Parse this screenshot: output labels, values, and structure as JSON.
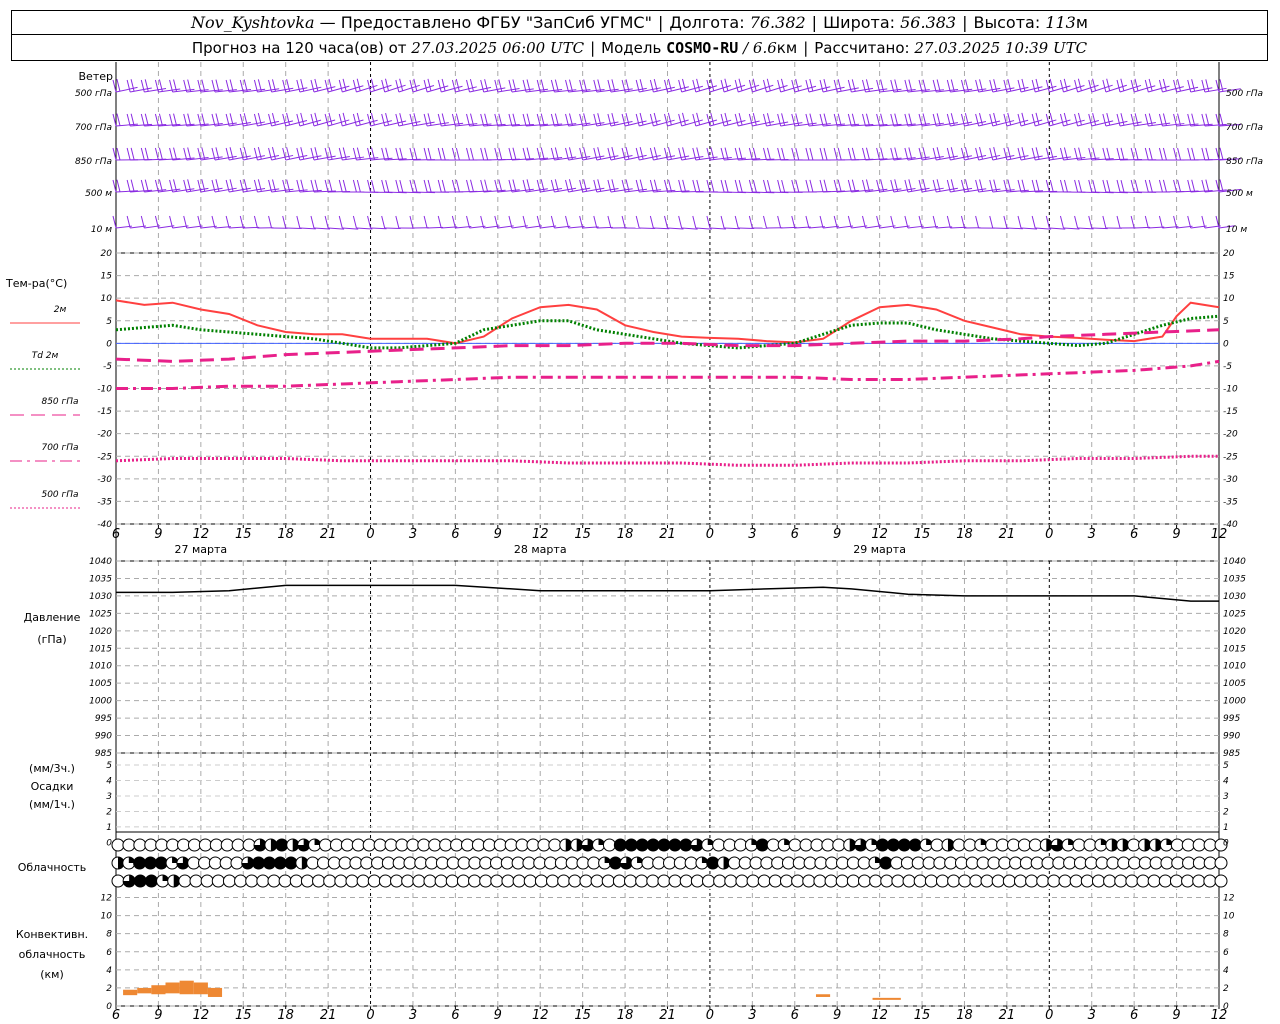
{
  "header": {
    "station": "Nov_Kyshtovka",
    "provider": "— Предоставлено ФГБУ \"ЗапСиб УГМС\"",
    "lon_label": "Долгота:",
    "lon_value": "76.382",
    "lat_label": "Широта:",
    "lat_value": "56.383",
    "alt_label": "Высота:",
    "alt_value": "113",
    "alt_unit": "м",
    "forecast_prefix": "Прогноз на 120 часа(ов) от",
    "forecast_start": "27.03.2025 06:00 UTC",
    "model_label": "Модель",
    "model_name": "COSMO-RU",
    "model_res": "/ 6.6",
    "model_res_unit": "км",
    "calc_label": "Рассчитано:",
    "calc_time": "27.03.2025 10:39 UTC"
  },
  "wind_panel": {
    "title": "Ветер",
    "levels": [
      "500 гПа",
      "700 гПа",
      "850 гПа",
      "500 м",
      "10  м"
    ]
  },
  "temp_panel": {
    "title": "Тем-ра(°С)",
    "legend": [
      {
        "label": "2м",
        "color": "#ff4040",
        "style": "solid"
      },
      {
        "label": "Td  2м",
        "color": "#008000",
        "style": "dotted"
      },
      {
        "label": "850 гПа",
        "color": "#e8208a",
        "style": "dashed"
      },
      {
        "label": "700 гПа",
        "color": "#e8208a",
        "style": "dashdot"
      },
      {
        "label": "500 гПа",
        "color": "#e8208a",
        "style": "dotted"
      }
    ]
  },
  "time_axis": {
    "hour_labels": [
      "6",
      "9",
      "12",
      "15",
      "18",
      "21",
      "0",
      "3",
      "6",
      "9",
      "12",
      "15",
      "18",
      "21",
      "0",
      "3",
      "6",
      "9",
      "12",
      "15",
      "18",
      "21",
      "0",
      "3",
      "6",
      "9",
      "12"
    ],
    "days": [
      "27 марта",
      "28 марта",
      "29 марта"
    ]
  },
  "pressure_panel": {
    "title": "Давление",
    "unit": "(гПа)"
  },
  "precip_panel": {
    "unit_top": "(мм/3ч.)",
    "title": "Осадки",
    "unit_bottom": "(мм/1ч.)"
  },
  "cloud_panel": {
    "title": "Облачность"
  },
  "conv_panel": {
    "title1": "Конвективн.",
    "title2": "облачность",
    "unit": "(км)"
  },
  "chart_data": {
    "type": "line",
    "x_hours": [
      0,
      3,
      6,
      9,
      12,
      15,
      18,
      21,
      24,
      27,
      30,
      33,
      36,
      39,
      42,
      45,
      48,
      51,
      54,
      57,
      60,
      63,
      66,
      69,
      72,
      75,
      78
    ],
    "temperature": {
      "ylim": [
        -40,
        20
      ],
      "ticks": [
        20,
        15,
        10,
        5,
        0,
        -5,
        -10,
        -15,
        -20,
        -25,
        -30,
        -35,
        -40
      ],
      "series": [
        {
          "name": "2м",
          "color": "#ff4040",
          "x": [
            0,
            2,
            4,
            6,
            8,
            10,
            12,
            14,
            16,
            18,
            20,
            22,
            24,
            26,
            28,
            30,
            32,
            34,
            36,
            38,
            40,
            42,
            44,
            46,
            48,
            50,
            52,
            54,
            56,
            58,
            60,
            62,
            64,
            66,
            68,
            70,
            72,
            74,
            75,
            76,
            78
          ],
          "y": [
            9.5,
            8.5,
            9,
            7.5,
            6.5,
            4,
            2.5,
            2,
            2,
            1,
            1,
            1,
            0,
            1.5,
            5.5,
            8,
            8.5,
            7.5,
            4,
            2.5,
            1.5,
            1.2,
            1,
            0.5,
            0.2,
            1,
            5,
            8,
            8.5,
            7.5,
            5,
            3.5,
            2,
            1.5,
            1.2,
            0.8,
            0.5,
            1.5,
            6,
            9,
            8
          ]
        },
        {
          "name": "Td 2м",
          "color": "#008000",
          "x": [
            0,
            2,
            4,
            6,
            8,
            10,
            12,
            14,
            16,
            18,
            20,
            22,
            24,
            26,
            28,
            30,
            32,
            34,
            36,
            38,
            40,
            42,
            44,
            46,
            48,
            50,
            52,
            54,
            56,
            58,
            60,
            62,
            64,
            66,
            68,
            70,
            72,
            74,
            76,
            78
          ],
          "y": [
            3,
            3.5,
            4,
            3,
            2.5,
            2,
            1.5,
            1,
            0,
            -1,
            -1,
            -0.5,
            0,
            3,
            4,
            5,
            5,
            3,
            2,
            1,
            0,
            -0.5,
            -1,
            -0.5,
            0,
            2,
            4,
            4.5,
            4.5,
            3,
            2,
            1,
            0.5,
            0,
            -0.5,
            0,
            2,
            4,
            5.5,
            6
          ]
        },
        {
          "name": "850 гПа",
          "color": "#e8208a",
          "x": [
            0,
            4,
            8,
            12,
            16,
            20,
            24,
            28,
            32,
            36,
            40,
            44,
            48,
            52,
            56,
            60,
            64,
            66,
            70,
            74,
            78
          ],
          "y": [
            -3.5,
            -4,
            -3.5,
            -2.5,
            -2,
            -1.5,
            -1,
            -0.5,
            -0.5,
            0,
            0,
            -0.5,
            -0.5,
            0,
            0.5,
            0.5,
            1,
            1.5,
            2,
            2.5,
            3
          ]
        },
        {
          "name": "700 гПа",
          "color": "#e8208a",
          "x": [
            0,
            4,
            8,
            12,
            16,
            20,
            24,
            28,
            32,
            36,
            40,
            44,
            48,
            52,
            56,
            60,
            64,
            68,
            72,
            76,
            78
          ],
          "y": [
            -10,
            -10,
            -9.5,
            -9.5,
            -9,
            -8.5,
            -8,
            -7.5,
            -7.5,
            -7.5,
            -7.5,
            -7.5,
            -7.5,
            -8,
            -8,
            -7.5,
            -7,
            -6.5,
            -6,
            -5,
            -4
          ]
        },
        {
          "name": "500 гПа",
          "color": "#e8208a",
          "x": [
            0,
            4,
            8,
            12,
            16,
            20,
            24,
            28,
            32,
            36,
            40,
            44,
            48,
            52,
            56,
            60,
            64,
            68,
            72,
            76,
            78
          ],
          "y": [
            -26,
            -25.5,
            -25.5,
            -25.5,
            -26,
            -26,
            -26,
            -26,
            -26.5,
            -26.5,
            -26.5,
            -27,
            -27,
            -26.5,
            -26.5,
            -26,
            -26,
            -25.5,
            -25.5,
            -25,
            -25
          ]
        }
      ]
    },
    "pressure": {
      "ylim": [
        985,
        1040
      ],
      "ticks": [
        1040,
        1035,
        1030,
        1025,
        1020,
        1015,
        1010,
        1005,
        1000,
        995,
        990,
        985
      ],
      "x": [
        0,
        4,
        8,
        12,
        16,
        20,
        24,
        28,
        30,
        34,
        38,
        42,
        46,
        50,
        52,
        56,
        60,
        64,
        68,
        72,
        76,
        78
      ],
      "y": [
        1031,
        1031,
        1031.5,
        1033,
        1033,
        1033,
        1033,
        1032,
        1031.5,
        1031.5,
        1031.5,
        1031.5,
        1032,
        1032.5,
        1032,
        1030.5,
        1030,
        1030,
        1030,
        1030,
        1028.5,
        1028.5
      ]
    },
    "precipitation": {
      "ylim": [
        0,
        5
      ],
      "ticks": [
        5,
        4,
        3,
        2,
        1,
        0
      ],
      "values": []
    },
    "convective_cloud": {
      "ylim": [
        0,
        13
      ],
      "ticks": [
        12,
        10,
        8,
        6,
        4,
        2,
        0
      ],
      "layers": [
        {
          "x0": 0.5,
          "x1": 1.5,
          "base": 1.2,
          "top": 1.8
        },
        {
          "x0": 1.5,
          "x1": 2.5,
          "base": 1.4,
          "top": 2.0
        },
        {
          "x0": 2.5,
          "x1": 3.5,
          "base": 1.3,
          "top": 2.3
        },
        {
          "x0": 3.5,
          "x1": 4.5,
          "base": 1.4,
          "top": 2.6
        },
        {
          "x0": 4.5,
          "x1": 5.5,
          "base": 1.3,
          "top": 2.8
        },
        {
          "x0": 5.5,
          "x1": 6.5,
          "base": 1.3,
          "top": 2.6
        },
        {
          "x0": 6.5,
          "x1": 7.5,
          "base": 1.0,
          "top": 2.0
        },
        {
          "x0": 49.5,
          "x1": 50.5,
          "base": 1.0,
          "top": 1.3
        },
        {
          "x0": 53.5,
          "x1": 55.5,
          "base": 0.7,
          "top": 0.9
        }
      ]
    },
    "cloudiness": {
      "rows": [
        "OOOOOOOOOOOOORHTHRQOOOOOOOOOOOOOOOOOOOOOOHHRQOTTTTTTTRQOOOQTOQOOOOOHRQTTTTQOHOOQOOOOOHRQOOQHHOHHQOOOOO",
        "HQTTTQROOOOORTTTTHOOOOOOOOOOOOOOOOOOOOOOOOOOOQTRQOOOOOQTHOOOOOOOOOOOOOQTOOOOOOOOOOOOOOOOOOOOOOOOOOOOOOO",
        "ORTTQHOOOOOOOOOOOOOOOOOOOOOOOOOOOOOOOOOOOOOOOOOOOOOOOOOOOOOOOOOOOOOOOOOOOOOOOOOOOOOOOOOOOOOOOOOOOOOO"
      ]
    }
  }
}
